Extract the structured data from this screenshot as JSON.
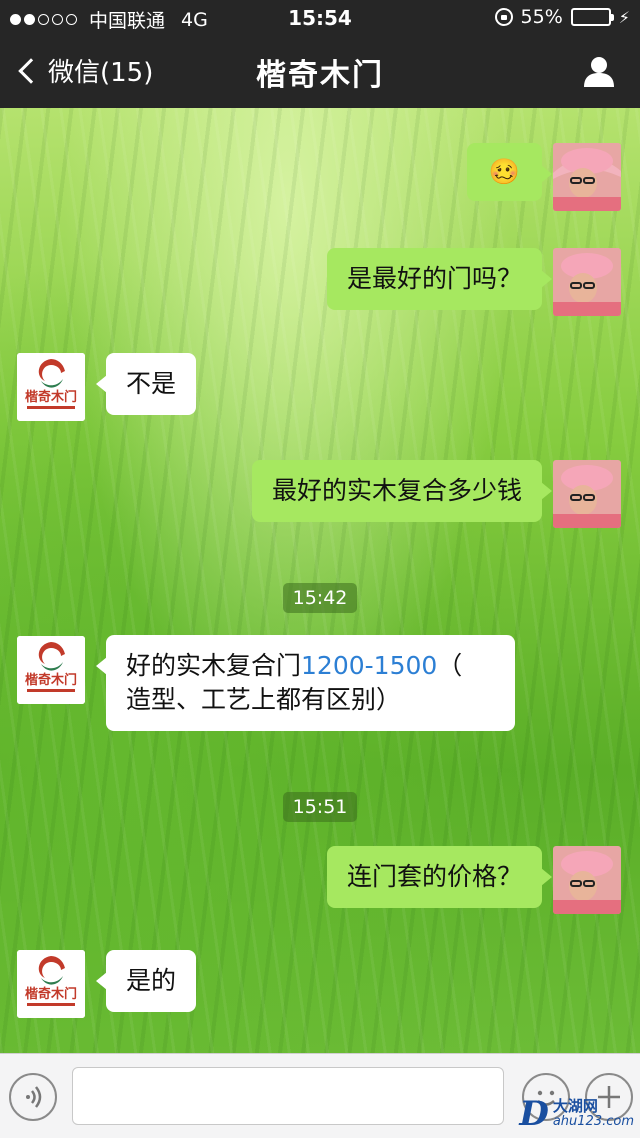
{
  "status_bar": {
    "carrier": "中国联通",
    "network": "4G",
    "time": "15:54",
    "battery": "55%",
    "battery_level": 0.55
  },
  "nav": {
    "back_label": "微信(15)",
    "title": "楷奇木门"
  },
  "brand_logo_text": "楷奇木门",
  "timestamps": [
    "15:42",
    "15:51"
  ],
  "messages": [
    {
      "from": "me",
      "type": "emoji",
      "emoji": "🥴"
    },
    {
      "from": "me",
      "text": "是最好的门吗？"
    },
    {
      "from": "other",
      "text": "不是"
    },
    {
      "from": "me",
      "text": "最好的实木复合多少钱"
    },
    {
      "from": "other",
      "text_parts": [
        "好的实木复合门",
        "1200-1500",
        "（",
        "造型、工艺上都有区别）"
      ]
    },
    {
      "from": "me",
      "text": "连门套的价格？"
    },
    {
      "from": "other",
      "text": "是的"
    }
  ],
  "input_bar": {
    "placeholder": ""
  },
  "watermark": {
    "logo": "D",
    "name": "大湖网",
    "url": "ahu123.com"
  },
  "colors": {
    "nav_bg": "#262626",
    "my_bubble": "#a6e860",
    "other_bubble": "#ffffff",
    "link": "#2c7fd4",
    "battery": "#4cd964"
  }
}
